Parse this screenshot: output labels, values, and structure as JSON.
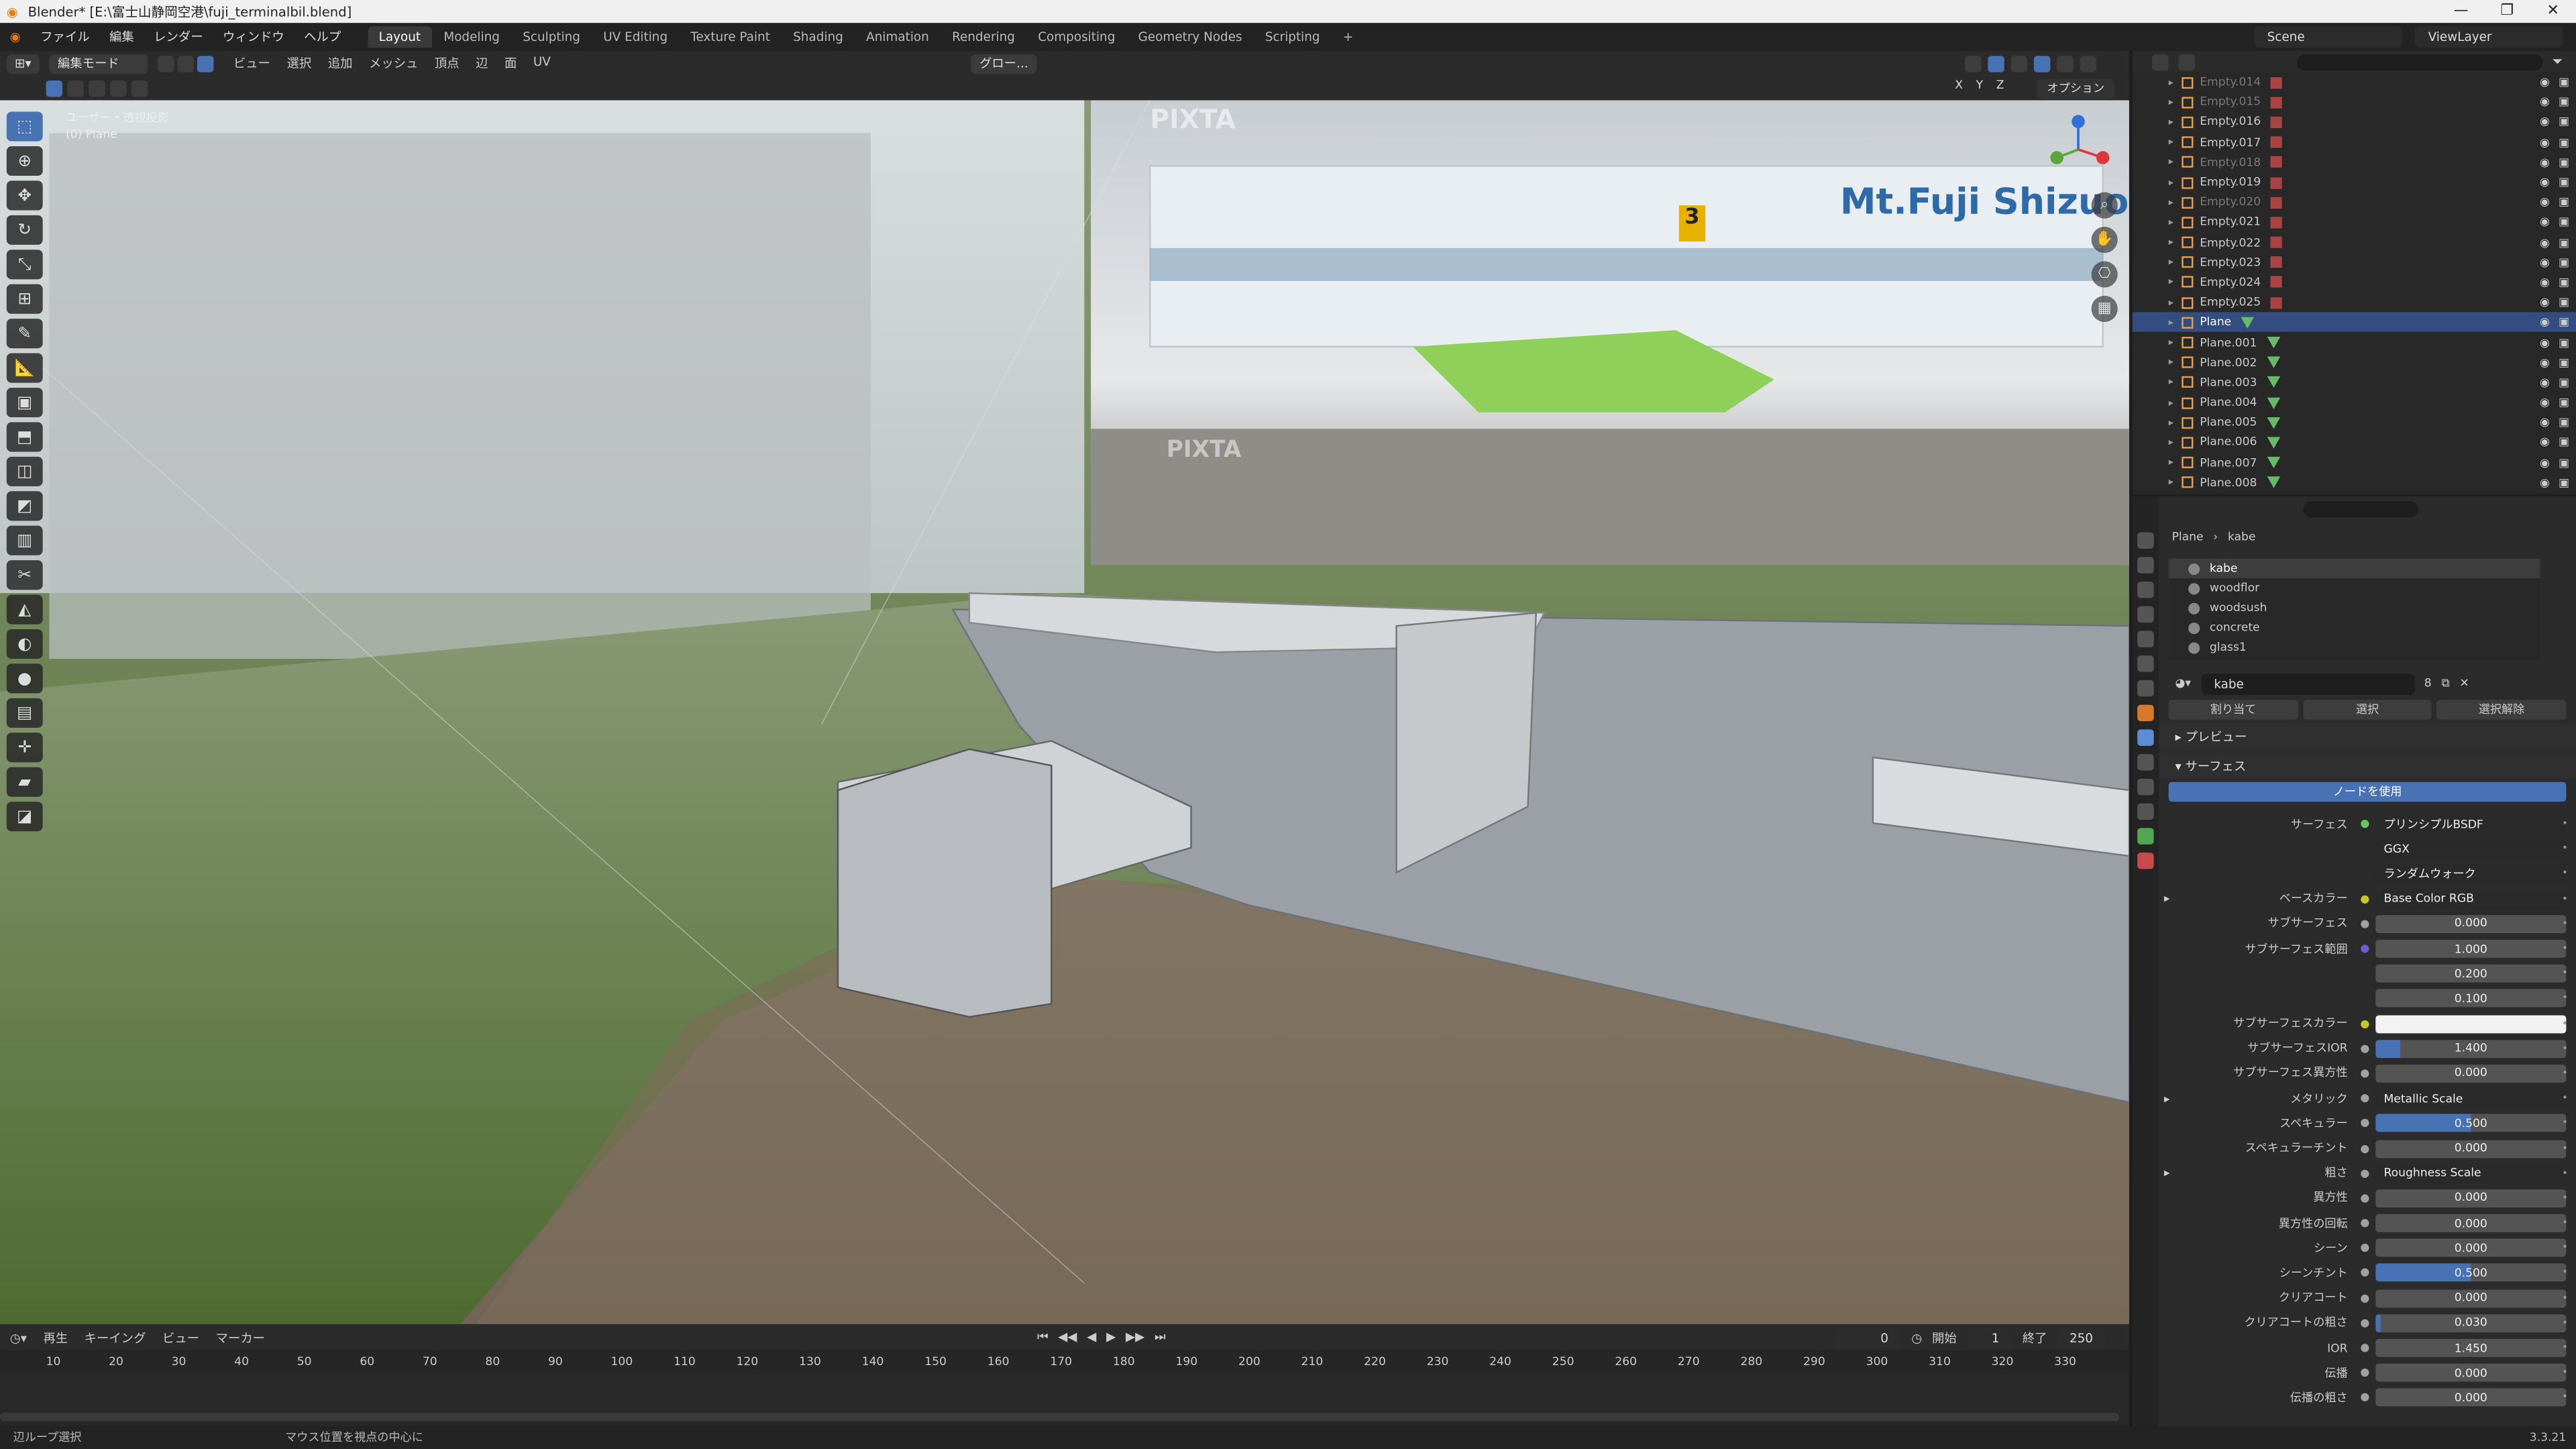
{
  "window": {
    "title": "Blender* [E:\\富士山静岡空港\\fuji_terminalbil.blend]"
  },
  "menu": [
    "ファイル",
    "編集",
    "レンダー",
    "ウィンドウ",
    "ヘルプ"
  ],
  "workspaces": [
    "Layout",
    "Modeling",
    "Sculpting",
    "UV Editing",
    "Texture Paint",
    "Shading",
    "Animation",
    "Rendering",
    "Compositing",
    "Geometry Nodes",
    "Scripting",
    "+"
  ],
  "scene": {
    "name": "Scene",
    "viewlayer": "ViewLayer"
  },
  "viewport": {
    "mode": "編集モード",
    "menus": [
      "ビュー",
      "選択",
      "追加",
      "メッシュ",
      "頂点",
      "辺",
      "面",
      "UV"
    ],
    "transform": "グロー...",
    "info_line1": "ユーザー・透視投影",
    "info_line2": "(0) Plane",
    "options": "オプション",
    "axes": [
      "X",
      "Y",
      "Z"
    ],
    "watermark": "PIXTA",
    "sign": "Mt.Fuji Shizuo",
    "gate": "3"
  },
  "outliner": [
    {
      "name": "Empty.014",
      "dim": true
    },
    {
      "name": "Empty.015",
      "dim": true
    },
    {
      "name": "Empty.016",
      "dim": false
    },
    {
      "name": "Empty.017",
      "dim": false
    },
    {
      "name": "Empty.018",
      "dim": true
    },
    {
      "name": "Empty.019",
      "dim": false
    },
    {
      "name": "Empty.020",
      "dim": true
    },
    {
      "name": "Empty.021",
      "dim": false
    },
    {
      "name": "Empty.022",
      "dim": false
    },
    {
      "name": "Empty.023",
      "dim": false
    },
    {
      "name": "Empty.024",
      "dim": false
    },
    {
      "name": "Empty.025",
      "dim": false
    },
    {
      "name": "Plane",
      "dim": false,
      "sel": true,
      "plane": true
    },
    {
      "name": "Plane.001",
      "plane": true
    },
    {
      "name": "Plane.002",
      "plane": true
    },
    {
      "name": "Plane.003",
      "plane": true
    },
    {
      "name": "Plane.004",
      "plane": true
    },
    {
      "name": "Plane.005",
      "plane": true
    },
    {
      "name": "Plane.006",
      "plane": true
    },
    {
      "name": "Plane.007",
      "plane": true
    },
    {
      "name": "Plane.008",
      "plane": true
    }
  ],
  "properties": {
    "breadcrumb": [
      "Plane",
      "kabe"
    ],
    "materials": [
      "kabe",
      "woodflor",
      "woodsush",
      "concrete",
      "glass1"
    ],
    "material_name": "kabe",
    "users": "8",
    "buttons": [
      "割り当て",
      "選択",
      "選択解除"
    ],
    "panels": {
      "preview": "プレビュー",
      "surface": "サーフェス",
      "use_nodes": "ノードを使用"
    },
    "rows": [
      {
        "label": "サーフェス",
        "value": "プリンシプルBSDF",
        "type": "text",
        "sock": "#63c763"
      },
      {
        "label": "",
        "value": "GGX",
        "type": "dropdown"
      },
      {
        "label": "",
        "value": "ランダムウォーク",
        "type": "dropdown"
      },
      {
        "label": "ベースカラー",
        "value": "Base Color RGB",
        "type": "text",
        "sock": "#c7c729",
        "exp": true
      },
      {
        "label": "サブサーフェス",
        "value": "0.000",
        "type": "num",
        "fill": 0,
        "sock": "#a1a1a1"
      },
      {
        "label": "サブサーフェス範囲",
        "value": "1.000",
        "type": "num",
        "fill": 0,
        "sock": "#6363c7"
      },
      {
        "label": "",
        "value": "0.200",
        "type": "num",
        "fill": 0
      },
      {
        "label": "",
        "value": "0.100",
        "type": "num",
        "fill": 0
      },
      {
        "label": "サブサーフェスカラー",
        "value": "",
        "type": "color",
        "sock": "#c7c729"
      },
      {
        "label": "サブサーフェスIOR",
        "value": "1.400",
        "type": "num",
        "fill": 0.13,
        "sock": "#a1a1a1"
      },
      {
        "label": "サブサーフェス異方性",
        "value": "0.000",
        "type": "num",
        "fill": 0,
        "sock": "#a1a1a1"
      },
      {
        "label": "メタリック",
        "value": "Metallic Scale",
        "type": "text",
        "sock": "#a1a1a1",
        "exp": true
      },
      {
        "label": "スペキュラー",
        "value": "0.500",
        "type": "num",
        "fill": 0.5,
        "sock": "#a1a1a1"
      },
      {
        "label": "スペキュラーチント",
        "value": "0.000",
        "type": "num",
        "fill": 0,
        "sock": "#a1a1a1"
      },
      {
        "label": "粗さ",
        "value": "Roughness Scale",
        "type": "text",
        "sock": "#a1a1a1",
        "exp": true
      },
      {
        "label": "異方性",
        "value": "0.000",
        "type": "num",
        "fill": 0,
        "sock": "#a1a1a1"
      },
      {
        "label": "異方性の回転",
        "value": "0.000",
        "type": "num",
        "fill": 0,
        "sock": "#a1a1a1"
      },
      {
        "label": "シーン",
        "value": "0.000",
        "type": "num",
        "fill": 0,
        "sock": "#a1a1a1"
      },
      {
        "label": "シーンチント",
        "value": "0.500",
        "type": "num",
        "fill": 0.5,
        "sock": "#a1a1a1"
      },
      {
        "label": "クリアコート",
        "value": "0.000",
        "type": "num",
        "fill": 0,
        "sock": "#a1a1a1"
      },
      {
        "label": "クリアコートの粗さ",
        "value": "0.030",
        "type": "num",
        "fill": 0.03,
        "sock": "#a1a1a1"
      },
      {
        "label": "IOR",
        "value": "1.450",
        "type": "num",
        "fill": 0,
        "sock": "#a1a1a1"
      },
      {
        "label": "伝播",
        "value": "0.000",
        "type": "num",
        "fill": 0,
        "sock": "#a1a1a1"
      },
      {
        "label": "伝播の粗さ",
        "value": "0.000",
        "type": "num",
        "fill": 0,
        "sock": "#a1a1a1"
      }
    ]
  },
  "timeline": {
    "menus": [
      "再生",
      "キーイング",
      "ビュー",
      "マーカー"
    ],
    "current": "0",
    "start_label": "開始",
    "start": "1",
    "end_label": "終了",
    "end": "250",
    "ticks": [
      "10",
      "20",
      "30",
      "40",
      "50",
      "60",
      "70",
      "80",
      "90",
      "100",
      "110",
      "120",
      "130",
      "140",
      "150",
      "160",
      "170",
      "180",
      "190",
      "200",
      "210",
      "220",
      "230",
      "240",
      "250",
      "260",
      "270",
      "280",
      "290",
      "300",
      "310",
      "320",
      "330"
    ]
  },
  "status": {
    "left": "辺ループ選択",
    "mid": "マウス位置を視点の中心に",
    "version": "3.3.21"
  }
}
